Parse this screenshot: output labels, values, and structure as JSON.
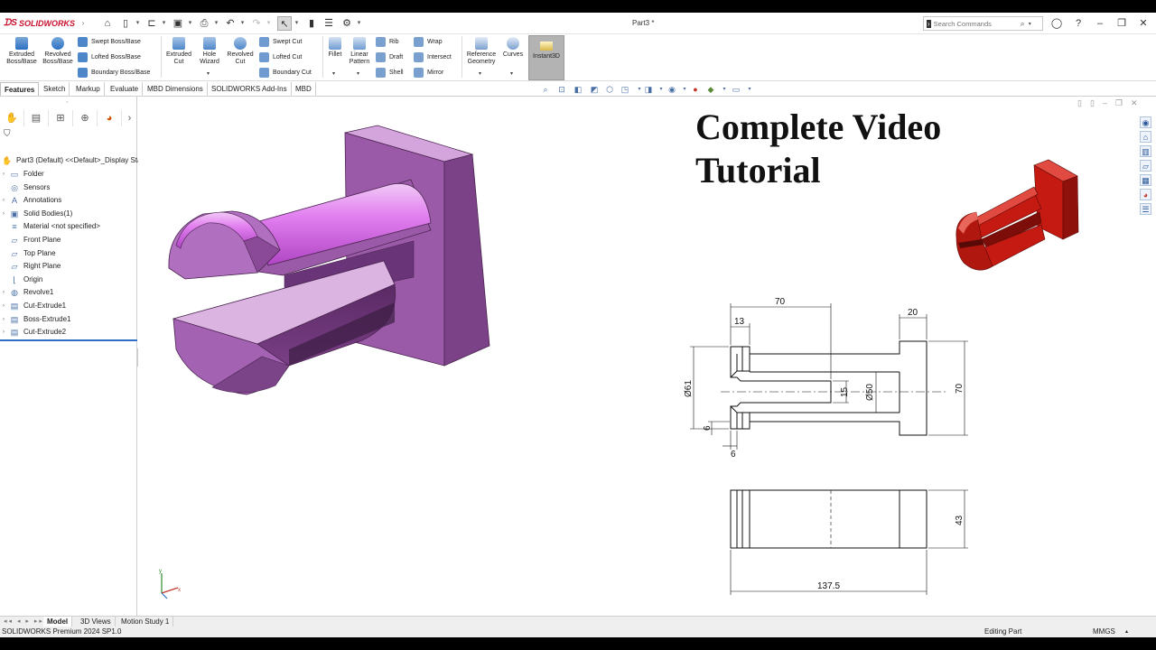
{
  "app": {
    "brand": "SOLIDWORKS",
    "document_title": "Part3 *"
  },
  "search": {
    "placeholder": "Search Commands"
  },
  "ribbon": {
    "extruded_boss": "Extruded Boss/Base",
    "revolved_boss": "Revolved Boss/Base",
    "swept_boss": "Swept Boss/Base",
    "lofted_boss": "Lofted Boss/Base",
    "boundary_boss": "Boundary Boss/Base",
    "extruded_cut": "Extruded Cut",
    "hole_wizard": "Hole Wizard",
    "revolved_cut": "Revolved Cut",
    "swept_cut": "Swept Cut",
    "lofted_cut": "Lofted Cut",
    "boundary_cut": "Boundary Cut",
    "fillet": "Fillet",
    "linear_pattern": "Linear Pattern",
    "rib": "Rib",
    "draft": "Draft",
    "shell": "Shell",
    "wrap": "Wrap",
    "intersect": "Intersect",
    "mirror": "Mirror",
    "reference_geometry": "Reference Geometry",
    "curves": "Curves",
    "instant3d": "Instant3D"
  },
  "tabs": [
    "Features",
    "Sketch",
    "Markup",
    "Evaluate",
    "MBD Dimensions",
    "SOLIDWORKS Add-Ins",
    "MBD"
  ],
  "tree": {
    "root": "Part3 (Default) <<Default>_Display Sta",
    "items": [
      "Folder",
      "Sensors",
      "Annotations",
      "Solid Bodies(1)",
      "Material <not specified>",
      "Front Plane",
      "Top Plane",
      "Right Plane",
      "Origin",
      "Revolve1",
      "Cut-Extrude1",
      "Boss-Extrude1",
      "Cut-Extrude2"
    ]
  },
  "overlay": {
    "line1": "Complete Video",
    "line2": "Tutorial"
  },
  "drawing": {
    "dims": [
      "70",
      "20",
      "13",
      "Ø61",
      "15",
      "Ø50",
      "70",
      "6",
      "6",
      "43",
      "137.5"
    ]
  },
  "bottom_tabs": [
    "Model",
    "3D Views",
    "Motion Study 1"
  ],
  "status": {
    "left": "SOLIDWORKS Premium 2024 SP1.0",
    "mode": "Editing Part",
    "units": "MMGS"
  },
  "colors": {
    "part_main": "#9b5aa8",
    "part_light": "#e5b6ee",
    "part_dark": "#6e3a7a",
    "preview_red": "#c41a12",
    "accent_blue": "#2d6fc4",
    "brand_red": "#c8102e"
  }
}
